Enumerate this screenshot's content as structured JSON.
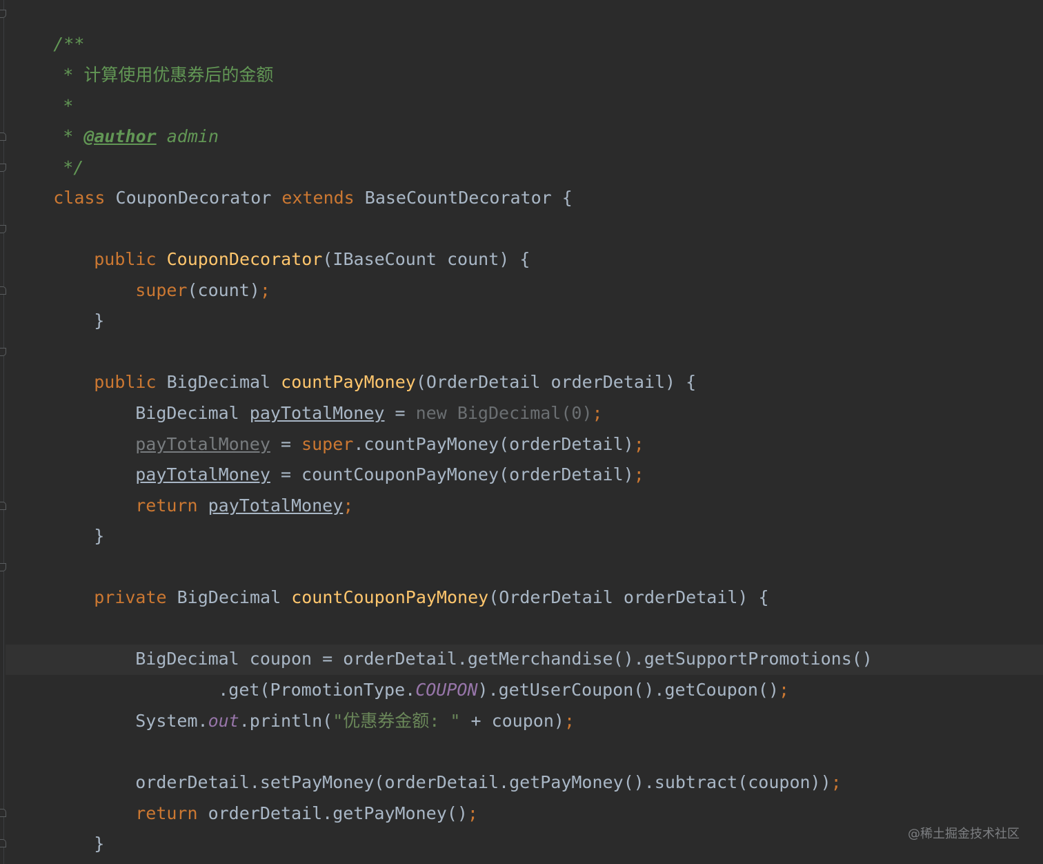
{
  "editor": {
    "background": "#2b2b2b",
    "colors": {
      "keyword": "#cc7832",
      "method_decl": "#ffc66d",
      "doc_comment": "#629755",
      "string": "#6a8759",
      "static_field": "#9876aa",
      "default_text": "#a9b7c6"
    }
  },
  "code": {
    "doc_open": "/**",
    "doc_star": "* ",
    "doc_desc": "计算使用优惠券后的金额",
    "doc_empty": "*",
    "doc_tag": "@author",
    "doc_author": " admin",
    "doc_close": "*/",
    "kw_class": "class",
    "class_name": " CouponDecorator ",
    "kw_extends": "extends",
    "base_class": " BaseCountDecorator {",
    "kw_public": "public",
    "ctor_name": "CouponDecorator",
    "ctor_params": "(IBaseCount count) {",
    "kw_super": "super",
    "super_args": "(count)",
    "semi": ";",
    "close_brace": "}",
    "m1_type": " BigDecimal ",
    "m1_name": "countPayMoney",
    "m1_params": "(OrderDetail orderDetail) {",
    "l1_type": "BigDecimal ",
    "var_name": "payTotalMoney",
    "l1_eq": " = ",
    "l1_init": "new BigDecimal(0)",
    "l2_eq": " = ",
    "l2_call": ".countPayMoney(orderDetail)",
    "l3_eq": " = countCouponPayMoney(orderDetail)",
    "kw_return": "return",
    "kw_private": "private",
    "m2_name": "countCouponPayMoney",
    "c1": "BigDecimal coupon = orderDetail.getMerchandise().getSupportPromotions()",
    "c2a": ".get(PromotionType.",
    "c2_const": "COUPON",
    "c2b": ").getUserCoupon().getCoupon()",
    "c3a": "System.",
    "c3_out": "out",
    "c3b": ".println(",
    "c3_str": "\"优惠券金额: \"",
    "c3c": " + coupon)",
    "c4": "orderDetail.setPayMoney(orderDetail.getPayMoney().subtract(coupon))",
    "c5": " orderDetail.getPayMoney()"
  },
  "watermark": "@稀土掘金技术社区"
}
